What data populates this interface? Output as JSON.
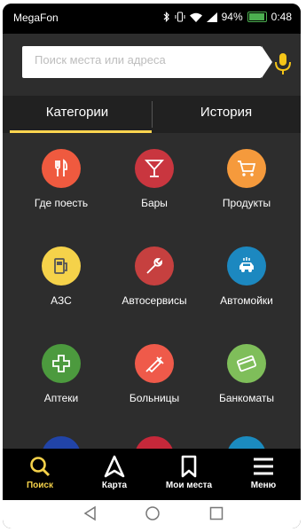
{
  "statusbar": {
    "carrier": "MegaFon",
    "battery": "94%",
    "battery_level": 0.94,
    "time": "0:48"
  },
  "search": {
    "placeholder": "Поиск места или адреса"
  },
  "tabs": [
    {
      "label": "Категории",
      "active": true
    },
    {
      "label": "История",
      "active": false
    }
  ],
  "colors": {
    "accent": "#ffd54f",
    "background": "#2d2d2d"
  },
  "categories": [
    {
      "label": "Где поесть",
      "icon": "fork-knife-icon",
      "color": "#ef5a3f"
    },
    {
      "label": "Бары",
      "icon": "cocktail-icon",
      "color": "#c9363f"
    },
    {
      "label": "Продукты",
      "icon": "cart-icon",
      "color": "#f59a3c"
    },
    {
      "label": "АЗС",
      "icon": "gas-station-icon",
      "color": "#f5d24a"
    },
    {
      "label": "Автосервисы",
      "icon": "wrench-icon",
      "color": "#c6403f"
    },
    {
      "label": "Автомойки",
      "icon": "car-wash-icon",
      "color": "#1c88c0"
    },
    {
      "label": "Аптеки",
      "icon": "pharmacy-cross-icon",
      "color": "#4c9a3e"
    },
    {
      "label": "Больницы",
      "icon": "syringe-icon",
      "color": "#ef5a4a"
    },
    {
      "label": "Банкоматы",
      "icon": "card-icon",
      "color": "#7fbe5a"
    },
    {
      "icon": "partial-icon",
      "color": "#2144a8"
    },
    {
      "icon": "partial-icon",
      "color": "#c6283a"
    },
    {
      "icon": "partial-icon",
      "color": "#1b8bbf"
    }
  ],
  "nav": [
    {
      "label": "Поиск",
      "icon": "search-icon",
      "active": true
    },
    {
      "label": "Карта",
      "icon": "navigation-arrow-icon",
      "active": false
    },
    {
      "label": "Мои места",
      "icon": "bookmark-icon",
      "active": false
    },
    {
      "label": "Меню",
      "icon": "menu-icon",
      "active": false
    }
  ]
}
